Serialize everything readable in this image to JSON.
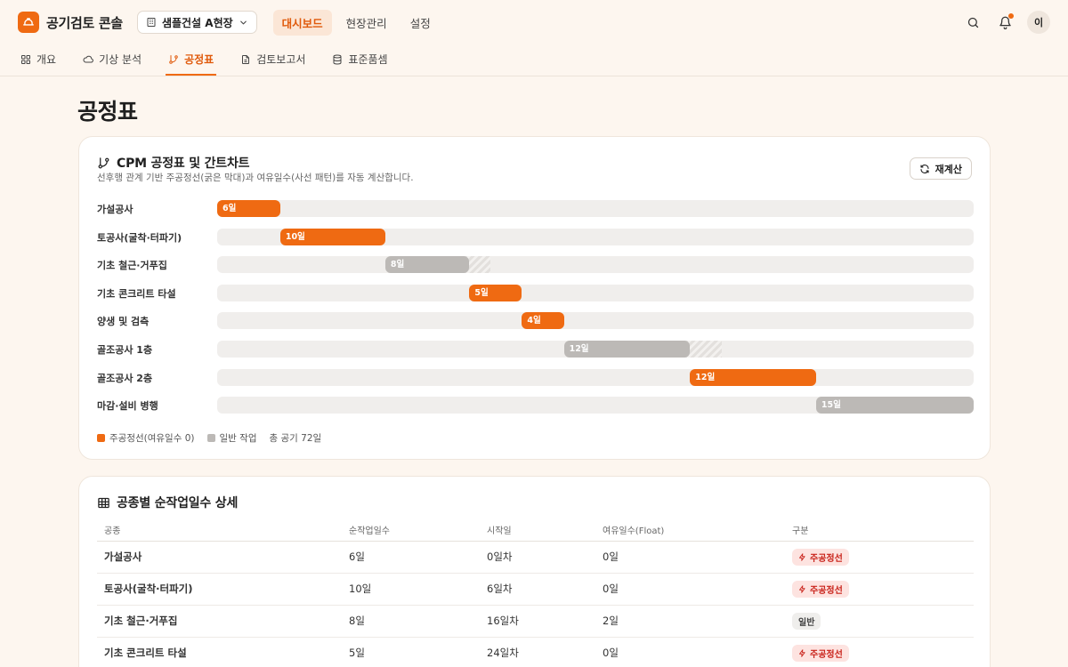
{
  "app": {
    "title": "공기검토 콘솔",
    "site": "샘플건설 A현장",
    "avatar": "이"
  },
  "nav": [
    {
      "label": "대시보드",
      "active": true
    },
    {
      "label": "현장관리",
      "active": false
    },
    {
      "label": "설정",
      "active": false
    }
  ],
  "tabs": [
    {
      "label": "개요",
      "icon": "grid-icon",
      "active": false
    },
    {
      "label": "기상 분석",
      "icon": "cloud-icon",
      "active": false
    },
    {
      "label": "공정표",
      "icon": "git-branch-icon",
      "active": true
    },
    {
      "label": "검토보고서",
      "icon": "file-icon",
      "active": false
    },
    {
      "label": "표준품셈",
      "icon": "database-icon",
      "active": false
    }
  ],
  "page": {
    "title": "공정표"
  },
  "gantt": {
    "title": "CPM 공정표 및 간트차트",
    "subtitle": "선후행 관계 기반 주공정선(굵은 막대)과 여유일수(사선 패턴)를 자동 계산합니다.",
    "recalc_label": "재계산",
    "total_days": 72,
    "tasks": [
      {
        "name": "가설공사",
        "start": 0,
        "duration": 6,
        "float": 0,
        "critical": true,
        "label": "6일"
      },
      {
        "name": "토공사(굴착·터파기)",
        "start": 6,
        "duration": 10,
        "float": 0,
        "critical": true,
        "label": "10일"
      },
      {
        "name": "기초 철근·거푸집",
        "start": 16,
        "duration": 8,
        "float": 2,
        "critical": false,
        "label": "8일"
      },
      {
        "name": "기초 콘크리트 타설",
        "start": 24,
        "duration": 5,
        "float": 0,
        "critical": true,
        "label": "5일"
      },
      {
        "name": "양생 및 검측",
        "start": 29,
        "duration": 4,
        "float": 0,
        "critical": true,
        "label": "4일"
      },
      {
        "name": "골조공사 1층",
        "start": 33,
        "duration": 12,
        "float": 3,
        "critical": false,
        "label": "12일"
      },
      {
        "name": "골조공사 2층",
        "start": 45,
        "duration": 12,
        "float": 0,
        "critical": true,
        "label": "12일"
      },
      {
        "name": "마감·설비 병행",
        "start": 57,
        "duration": 15,
        "float": 0,
        "critical": false,
        "label": "15일"
      }
    ],
    "legend": {
      "critical": "주공정선(여유일수 0)",
      "normal": "일반 작업",
      "total": "총 공기 72일"
    },
    "colors": {
      "critical": "#ef6a12",
      "normal": "#bcb9b6"
    }
  },
  "table": {
    "title": "공종별 순작업일수 상세",
    "headers": [
      "공종",
      "순작업일수",
      "시작일",
      "여유일수(Float)",
      "구분"
    ],
    "rows": [
      {
        "name": "가설공사",
        "duration": "6일",
        "start": "0일차",
        "float": "0일",
        "type": "주공정선",
        "critical": true
      },
      {
        "name": "토공사(굴착·터파기)",
        "duration": "10일",
        "start": "6일차",
        "float": "0일",
        "type": "주공정선",
        "critical": true
      },
      {
        "name": "기초 철근·거푸집",
        "duration": "8일",
        "start": "16일차",
        "float": "2일",
        "type": "일반",
        "critical": false
      },
      {
        "name": "기초 콘크리트 타설",
        "duration": "5일",
        "start": "24일차",
        "float": "0일",
        "type": "주공정선",
        "critical": true
      }
    ]
  }
}
